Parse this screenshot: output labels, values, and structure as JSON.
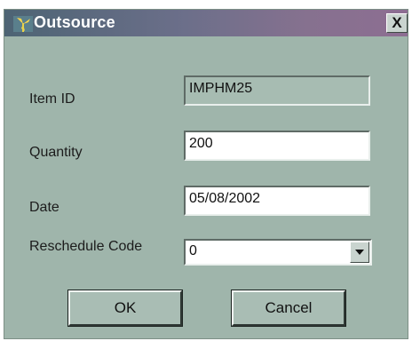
{
  "window": {
    "title": "Outsource",
    "app_icon": "windmill-icon",
    "close_label": "X"
  },
  "form": {
    "item_id": {
      "label": "Item ID",
      "value": "IMPHM25"
    },
    "quantity": {
      "label": "Quantity",
      "value": "200"
    },
    "date": {
      "label": "Date",
      "value": "05/08/2002"
    },
    "reschedule_code": {
      "label": "Reschedule Code",
      "value": "0"
    }
  },
  "buttons": {
    "ok": "OK",
    "cancel": "Cancel"
  },
  "colors": {
    "dialog_bg": "#9fb5ab",
    "title_gradient_start": "#4d6474",
    "title_gradient_end": "#8d6e92"
  }
}
